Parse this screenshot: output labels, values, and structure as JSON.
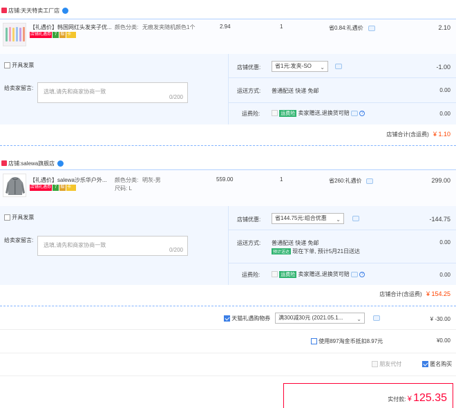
{
  "stores": [
    {
      "label": "店铺:",
      "name": "天天特卖工厂店",
      "item": {
        "title": "【礼遇价】韩国网红头发夹子优...",
        "sku_label": "颜色分类:",
        "sku_value": "无痕发夹随机颜色1个",
        "sku_extra": "",
        "price": "2.94",
        "qty": "1",
        "discount": "省0.84:礼遇价",
        "subtotal": "2.10",
        "badge_main": "店铺礼遇券",
        "badge_7": "7",
        "badge_c": "赔",
        "badge_k": "卡"
      },
      "wholesale_label": "开具发票",
      "message_label": "给卖家留言:",
      "message_placeholder": "选填,请先和商家协商一致",
      "message_count": "0/200",
      "promo_label": "店铺优惠:",
      "promo_value": "省1元:发夹-SO",
      "promo_amount": "-1.00",
      "ship_label": "运送方式:",
      "ship_value": "普通配送 快递 免邮",
      "ship_extra_tag": "",
      "ship_extra": "",
      "ship_amount": "0.00",
      "ins_label": "运费险:",
      "ins_tag": "运费险",
      "ins_text": "卖家赠送,退换货可赔",
      "ins_amount": "0.00",
      "total_label": "店铺合计(含运费)",
      "total_value": "¥ 1.10"
    },
    {
      "label": "店铺:",
      "name": "salewa旗舰店",
      "item": {
        "title": "【礼遇价】salewa沙乐华户外...",
        "sku_label": "颜色分类:",
        "sku_value": "明灰-男",
        "sku_extra": "尺码: L",
        "price": "559.00",
        "qty": "1",
        "discount": "省260:礼遇价",
        "subtotal": "299.00",
        "badge_main": "店铺礼遇券",
        "badge_7": "7",
        "badge_c": "赔",
        "badge_k": "卡"
      },
      "wholesale_label": "开具发票",
      "message_label": "给卖家留言:",
      "message_placeholder": "选填,请先和商家协商一致",
      "message_count": "0/200",
      "promo_label": "店铺优惠:",
      "promo_value": "省144.75元:组合优惠",
      "promo_amount": "-144.75",
      "ship_label": "运送方式:",
      "ship_value": "普通配送 快递 免邮",
      "ship_extra_tag": "预计送达",
      "ship_extra": "现在下单, 预计5月21日送达",
      "ship_amount": "0.00",
      "ins_label": "运费险:",
      "ins_tag": "运费险",
      "ins_text": "卖家赠送,退换货可赔",
      "ins_amount": "0.00",
      "total_label": "店铺合计(含运费)",
      "total_value": "¥ 154.25"
    }
  ],
  "coupon": {
    "label": "天猫礼遇购物券",
    "value": "满300减30元 (2021.05.1...",
    "amount": "¥ -30.00"
  },
  "taojinbi": {
    "label": "使用897淘金币抵扣8.97元",
    "amount": "¥0.00"
  },
  "friend_pay": "朋友代付",
  "anonymous": "匿名购买",
  "final": {
    "label": "实付款:",
    "currency": "¥",
    "value": "125.35"
  },
  "colors": {
    "accent_red": "#ff0036",
    "link_blue": "#3c7fe6",
    "panel_blue": "#f2f7ff"
  }
}
